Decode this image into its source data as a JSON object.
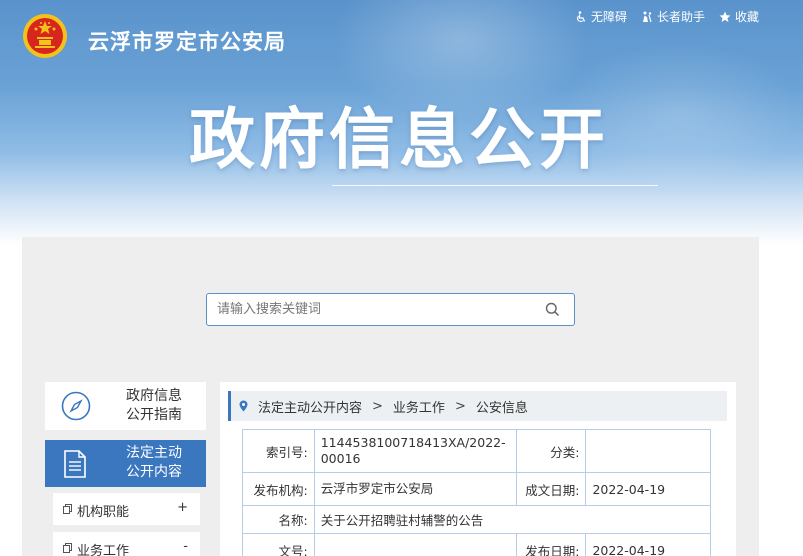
{
  "header": {
    "site_title": "云浮市罗定市公安局",
    "big_title": "政府信息公开",
    "links": [
      {
        "label": "无障碍",
        "icon": "wheelchair-icon"
      },
      {
        "label": "长者助手",
        "icon": "elder-assist-icon"
      },
      {
        "label": "收藏",
        "icon": "star-icon"
      }
    ]
  },
  "search": {
    "placeholder": "请输入搜索关键词",
    "value": ""
  },
  "sidebar": {
    "guide_label_1": "政府信息",
    "guide_label_2": "公开指南",
    "active_label_1": "法定主动",
    "active_label_2": "公开内容",
    "items": [
      {
        "label": "机构职能",
        "sign": "+"
      },
      {
        "label": "业务工作",
        "sign": "-"
      }
    ]
  },
  "breadcrumb": {
    "items": [
      "法定主动公开内容",
      "业务工作",
      "公安信息"
    ]
  },
  "meta": {
    "index_key": "索引号:",
    "index_value": "1144538100718413XA/2022-00016",
    "category_key": "分类:",
    "category_value": "",
    "publisher_key": "发布机构:",
    "publisher_value": "云浮市罗定市公安局",
    "written_date_key": "成文日期:",
    "written_date_value": "2022-04-19",
    "name_key": "名称:",
    "name_value": "关于公开招聘驻村辅警的公告",
    "doc_no_key": "文号:",
    "doc_no_value": "",
    "publish_date_key": "发布日期:",
    "publish_date_value": "2022-04-19"
  },
  "colors": {
    "accent": "#3a77bf",
    "banner_top": "#5a93cc",
    "panel_bg": "#eeeeee",
    "table_border": "#b7cde6"
  }
}
